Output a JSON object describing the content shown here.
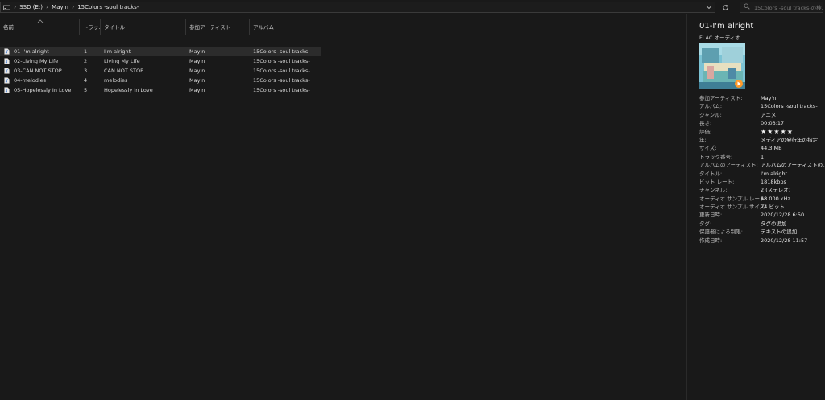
{
  "address_bar": {
    "crumbs": [
      "SSD (E:)",
      "May'n",
      "15Colors -soul tracks-"
    ],
    "search_placeholder": "15Colors -soul tracks-の検..."
  },
  "columns": [
    "名前",
    "トラッ...",
    "タイトル",
    "参加アーティスト",
    "アルバム"
  ],
  "files": [
    {
      "name": "01-I'm alright",
      "track": "1",
      "title": "I'm alright",
      "artist": "May'n",
      "album": "15Colors -soul tracks-",
      "selected": true
    },
    {
      "name": "02-Living My Life",
      "track": "2",
      "title": "Living My Life",
      "artist": "May'n",
      "album": "15Colors -soul tracks-",
      "selected": false
    },
    {
      "name": "03-CAN NOT STOP",
      "track": "3",
      "title": "CAN NOT STOP",
      "artist": "May'n",
      "album": "15Colors -soul tracks-",
      "selected": false
    },
    {
      "name": "04-melodies",
      "track": "4",
      "title": "melodies",
      "artist": "May'n",
      "album": "15Colors -soul tracks-",
      "selected": false
    },
    {
      "name": "05-Hopelessly In Love",
      "track": "5",
      "title": "Hopelessly In Love",
      "artist": "May'n",
      "album": "15Colors -soul tracks-",
      "selected": false
    }
  ],
  "details": {
    "title": "01-I'm alright",
    "subtitle": "FLAC オーディオ",
    "properties": [
      {
        "key": "参加アーティスト:",
        "value": "May'n"
      },
      {
        "key": "アルバム:",
        "value": "15Colors -soul tracks-"
      },
      {
        "key": "ジャンル:",
        "value": "アニメ"
      },
      {
        "key": "長さ:",
        "value": "00:03:17"
      },
      {
        "key": "評価:",
        "value": "★★★★★"
      },
      {
        "key": "年:",
        "value": "メディアの発行年の指定"
      },
      {
        "key": "サイズ:",
        "value": "44.3 MB"
      },
      {
        "key": "トラック番号:",
        "value": "1"
      },
      {
        "key": "アルバムのアーティスト:",
        "value": "アルバムのアーティストの..."
      },
      {
        "key": "タイトル:",
        "value": "I'm alright"
      },
      {
        "key": "ビット レート:",
        "value": "1818kbps"
      },
      {
        "key": "チャンネル:",
        "value": "2 (ステレオ)"
      },
      {
        "key": "オーディオ サンプル レート:",
        "value": "48.000 kHz"
      },
      {
        "key": "オーディオ サンプル サイズ:",
        "value": "24 ビット"
      },
      {
        "key": "更新日時:",
        "value": "2020/12/28 6:50"
      },
      {
        "key": "タグ:",
        "value": "タグの追加"
      },
      {
        "key": "保護者による制限:",
        "value": "テキストの追加"
      },
      {
        "key": "作成日時:",
        "value": "2020/12/28 11:57"
      }
    ]
  },
  "icons": {
    "drive": "drive-icon",
    "chevron": "chevron-right-icon",
    "dropdown": "chevron-down-icon",
    "refresh": "refresh-icon",
    "search": "search-icon",
    "file": "audio-file-icon"
  }
}
